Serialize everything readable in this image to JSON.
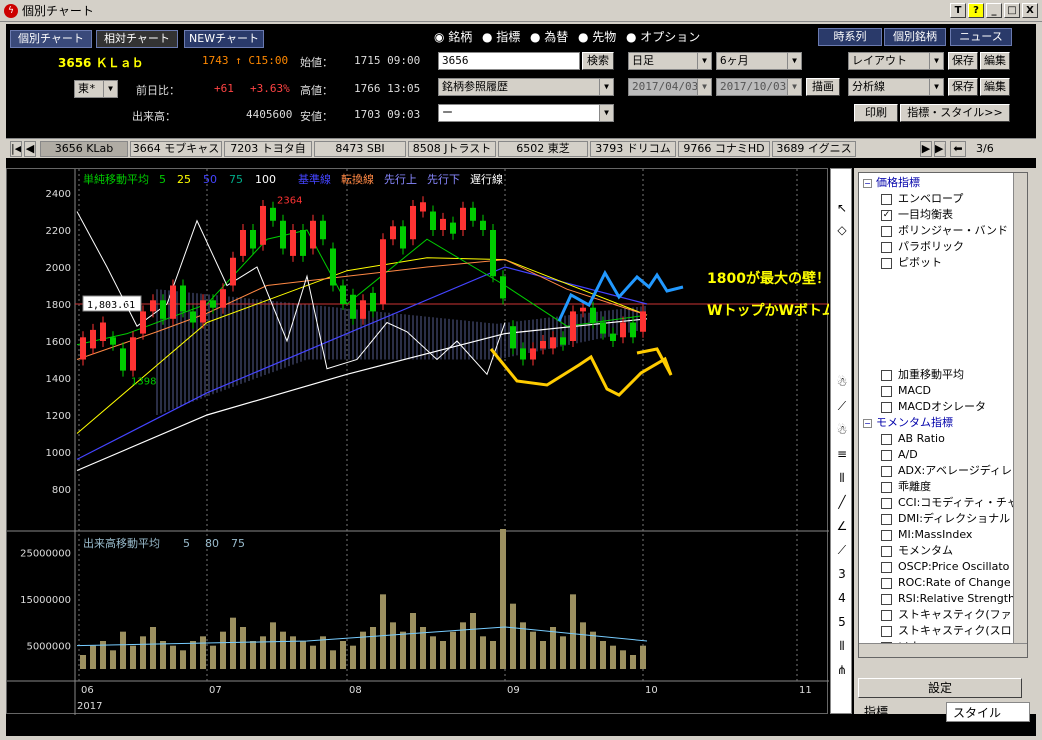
{
  "window": {
    "title": "個別チャート",
    "buttons": [
      "T",
      "?",
      "_",
      "□",
      "X"
    ]
  },
  "nav": {
    "individual": "個別チャート",
    "relative": "相対チャート",
    "new_chart": "NEWチャート"
  },
  "stock": {
    "code_name": "3656 ＫＬａｂ",
    "price": "1743 ↑ C15:00",
    "market": "東*",
    "prev_label": "前日比：",
    "prev_diff": "+61",
    "prev_pct": "+3.63%",
    "volume_label": "出来高：",
    "volume": "4405600",
    "open_label": "始値：",
    "open_val": "1715 09:00",
    "high_label": "高値：",
    "high_val": "1766 13:05",
    "low_label": "安値：",
    "low_val": "1703 09:03"
  },
  "radios": [
    "銘柄",
    "指標",
    "為替",
    "先物",
    "オプション"
  ],
  "search": {
    "code": "3656",
    "search_btn": "検索",
    "history": "銘柄参照履歴",
    "blank": "ー"
  },
  "period": {
    "interval": "日足",
    "span": "6ヶ月",
    "from": "2017/04/03",
    "to": "2017/10/03",
    "draw_btn": "描画"
  },
  "rightbtns": {
    "timeseries": "時系列",
    "individual": "個別銘柄",
    "news": "ニュース",
    "layout": "レイアウト",
    "save1": "保存",
    "edit1": "編集",
    "analysis": "分析線",
    "save2": "保存",
    "edit2": "編集",
    "print": "印刷",
    "indicator_style": "指標・スタイル>>"
  },
  "tabs": [
    "3656 KLab",
    "3664 モブキャス",
    "7203 トヨタ自",
    "8473 SBI",
    "8508 Jトラスト",
    "6502 東芝",
    "3793 ドリコム",
    "9766 コナミHD",
    "3689 イグニス"
  ],
  "tab_page": "3/6",
  "chart": {
    "legend_sma": "単純移動平均",
    "sma_periods": [
      "5",
      "25",
      "50",
      "75",
      "100"
    ],
    "legend_kijun": "基準線",
    "legend_tenkan": "転換線",
    "legend_senkou1": "先行上",
    "legend_senkou2": "先行下",
    "legend_chikou": "遅行線",
    "price_ticks": [
      "2400",
      "2200",
      "2000",
      "1800",
      "1600",
      "1400",
      "1200",
      "1000",
      "800"
    ],
    "current_label": "1,803.61",
    "high_mark": "2364",
    "low_mark": "1398",
    "annotation1": "1800が最大の壁！！",
    "annotation2": "WトップかWボトムかの天王山！",
    "vol_legend": "出来高移動平均",
    "vol_periods": [
      "5",
      "80",
      "75"
    ],
    "vol_ticks": [
      "25000000",
      "15000000",
      "5000000"
    ],
    "x_ticks": [
      "06",
      "07",
      "08",
      "09",
      "10",
      "11"
    ],
    "year": "2017"
  },
  "indicators": [
    {
      "label": "価格指標",
      "head": true
    },
    {
      "label": "エンベロープ",
      "checked": false
    },
    {
      "label": "一目均衡表",
      "checked": true
    },
    {
      "label": "ボリンジャー・バンド",
      "checked": false
    },
    {
      "label": "パラボリック",
      "checked": false
    },
    {
      "label": "ピボット",
      "checked": false
    },
    {
      "label": "加重移動平均",
      "checked": false
    },
    {
      "label": "MACD",
      "checked": false
    },
    {
      "label": "MACDオシレータ",
      "checked": false
    },
    {
      "label": "モメンタム指標",
      "head": true
    },
    {
      "label": "AB Ratio",
      "checked": false
    },
    {
      "label": "A/D",
      "checked": false
    },
    {
      "label": "ADX:アベレージディレ",
      "checked": false
    },
    {
      "label": "乖離度",
      "checked": false
    },
    {
      "label": "CCI:コモディティ・チャ",
      "checked": false
    },
    {
      "label": "DMI:ディレクショナル",
      "checked": false
    },
    {
      "label": "MI:MassIndex",
      "checked": false
    },
    {
      "label": "モメンタム",
      "checked": false
    },
    {
      "label": "OSCP:Price Oscillato",
      "checked": false
    },
    {
      "label": "ROC:Rate of Change",
      "checked": false
    },
    {
      "label": "RSI:Relative Strength",
      "checked": false
    },
    {
      "label": "ストキャスティク(ファ",
      "checked": false
    },
    {
      "label": "ストキャスティク(スロ",
      "checked": false
    },
    {
      "label": "ソナー",
      "checked": false
    }
  ],
  "panel": {
    "settings_btn": "設定",
    "tab_indicator": "指標",
    "tab_style": "スタイル"
  }
}
